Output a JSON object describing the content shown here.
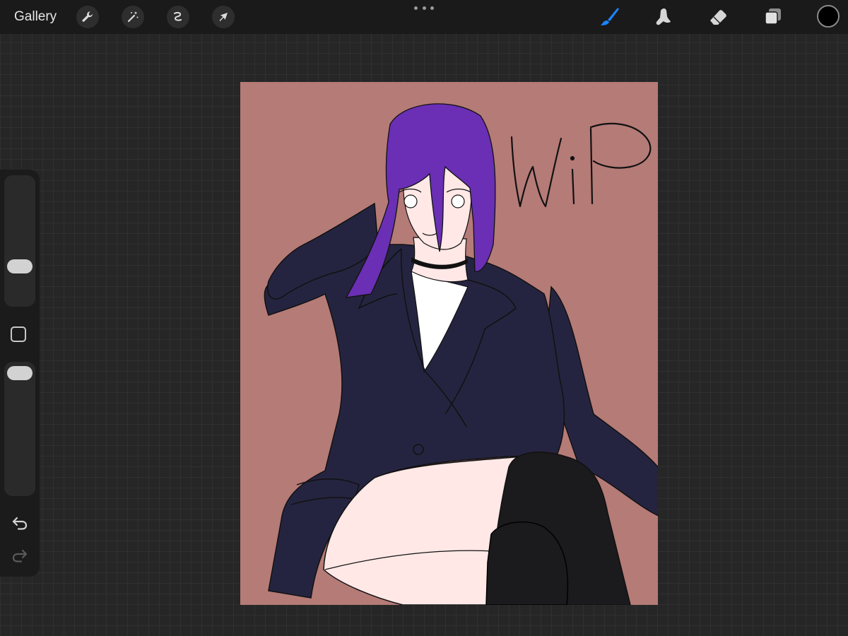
{
  "topbar": {
    "gallery_label": "Gallery",
    "left_tools": [
      "wrench-icon",
      "magic-wand-icon",
      "selection-icon",
      "transform-arrow-icon"
    ],
    "right_tools": [
      "brush-icon",
      "smudge-icon",
      "eraser-icon",
      "layers-icon"
    ],
    "active_tool": "brush-icon",
    "active_color": "#000000",
    "accent_color": "#1a84ff"
  },
  "sidebar": {
    "brush_size": 0.5,
    "opacity": 1.0,
    "icons": [
      "modify-square-icon",
      "undo-icon",
      "redo-icon"
    ]
  },
  "canvas": {
    "background_color": "#b57b77",
    "annotation_text": "WiP",
    "hair_color": "#6a2fb4",
    "jacket_color": "#252440",
    "skin_color": "#ffe8e6",
    "stocking_color": "#1b1a1d"
  }
}
